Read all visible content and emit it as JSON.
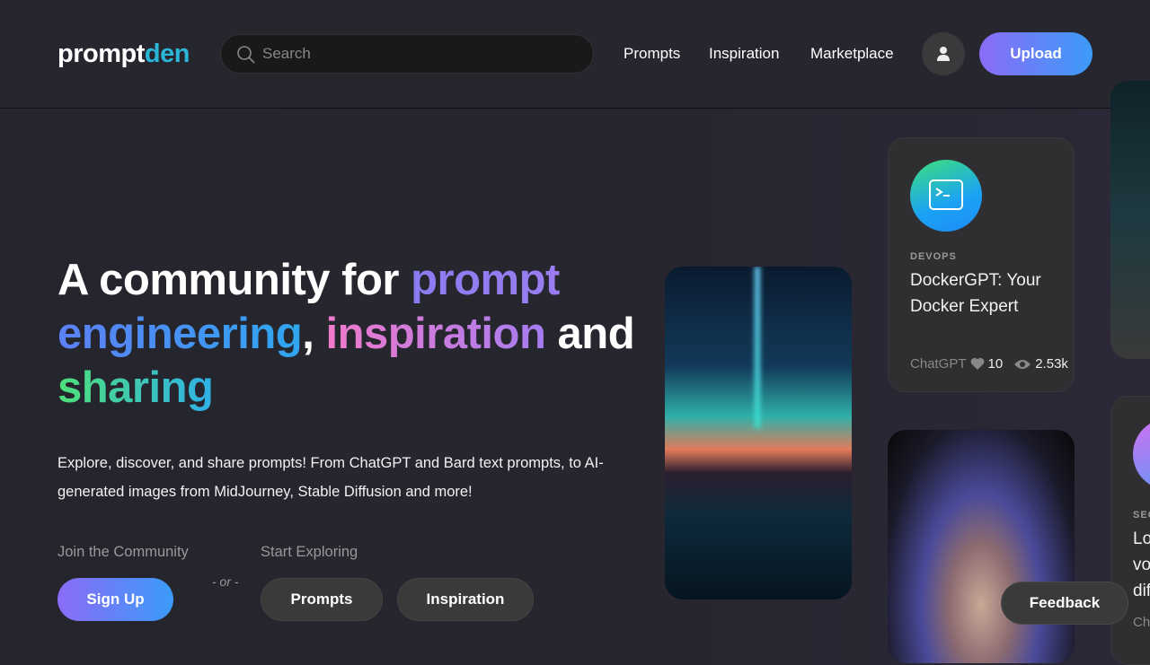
{
  "header": {
    "logo_a": "prompt",
    "logo_b": "den",
    "search_placeholder": "Search",
    "nav": [
      "Prompts",
      "Inspiration",
      "Marketplace"
    ],
    "upload": "Upload"
  },
  "hero": {
    "t1": "A community for ",
    "t2": "prompt",
    "t3": "engineering",
    "t4": ", ",
    "t5": "inspiration",
    "t6": " and",
    "t7": "sharing",
    "description": "Explore, discover, and share prompts! From ChatGPT and Bard text prompts, to AI-generated images from MidJourney, Stable Diffusion and more!",
    "join_label": "Join the Community",
    "explore_label": "Start Exploring",
    "or": "- or -",
    "signup": "Sign Up",
    "prompts": "Prompts",
    "inspiration": "Inspiration"
  },
  "cards": [
    {
      "category": "DEVOPS",
      "title": "DockerGPT: Your Docker Expert",
      "model": "ChatGPT",
      "likes": "10",
      "views": "2.53k",
      "icon": "terminal-icon"
    },
    {
      "category": "SEC",
      "title": "Lo vo dif",
      "model": "Cha"
    }
  ],
  "feedback": "Feedback",
  "colors": {
    "accent_start": "#8b6cf7",
    "accent_end": "#3b9bf8",
    "logo_accent": "#2bb6d8"
  }
}
